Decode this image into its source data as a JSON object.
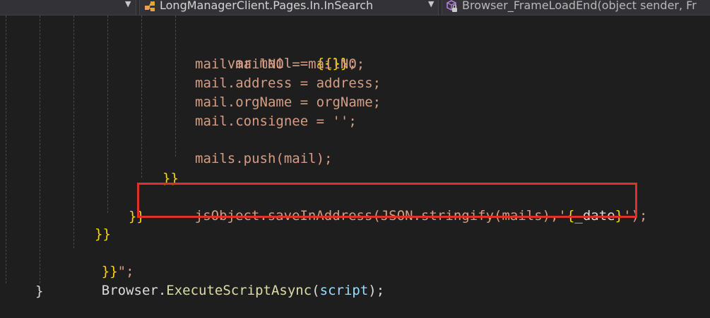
{
  "navbar": {
    "dropdown_left": {
      "label": "",
      "chevron": "▼"
    },
    "dropdown_class": {
      "icon": "class-icon",
      "label": "LongManagerClient.Pages.In.InSearch",
      "chevron": "▼"
    },
    "dropdown_member": {
      "icon": "method-icon",
      "label": "Browser_FrameLoadEnd(object sender, Fr"
    }
  },
  "code": {
    "line_var_mail": "var mail = ",
    "line_var_mail_braces": "{{}}",
    "line_var_mail_end": ";",
    "line_mailNO": "mail.mailNO = mailNO;",
    "line_address": "mail.address = address;",
    "line_orgName": "mail.orgName = orgName;",
    "line_consignee": "mail.consignee = '';",
    "line_push": "mails.push(mail);",
    "line_close_inner": "}}",
    "line_js_a": "jsObject.saveInAddress(JSON.stringify(mails),'",
    "line_js_brace_open": "{",
    "line_js_var": "_date",
    "line_js_brace_close": "}",
    "line_js_b": "');",
    "line_close_mid": "}}",
    "line_close_outer": "}}",
    "line_close_string_braces": "}}",
    "line_close_string_quote": "\";",
    "line_exec_obj": "Browser.",
    "line_exec_method": "ExecuteScriptAsync",
    "line_exec_open": "(",
    "line_exec_arg": "script",
    "line_exec_close": ");",
    "line_final_brace": "}"
  },
  "colors": {
    "background": "#1e1e1e",
    "string": "#d69d85",
    "brace_highlight": "#ffd700",
    "method": "#dcdcaa",
    "parameter": "#9cdcfe",
    "annotation_box": "#e0302c"
  }
}
